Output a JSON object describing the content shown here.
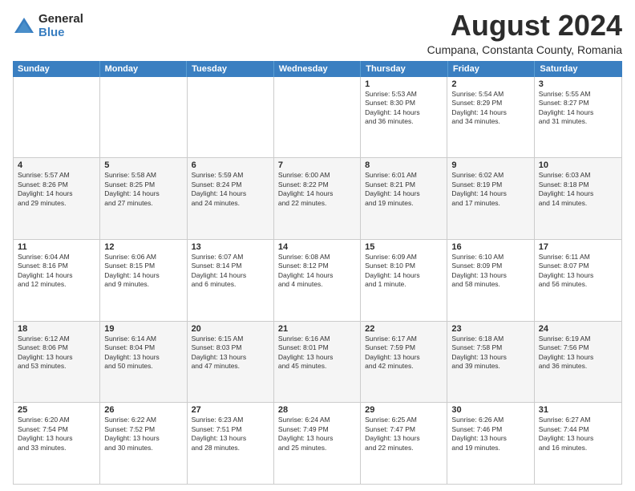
{
  "logo": {
    "general": "General",
    "blue": "Blue"
  },
  "title": "August 2024",
  "location": "Cumpana, Constanta County, Romania",
  "header_days": [
    "Sunday",
    "Monday",
    "Tuesday",
    "Wednesday",
    "Thursday",
    "Friday",
    "Saturday"
  ],
  "rows": [
    [
      {
        "day": "",
        "info": ""
      },
      {
        "day": "",
        "info": ""
      },
      {
        "day": "",
        "info": ""
      },
      {
        "day": "",
        "info": ""
      },
      {
        "day": "1",
        "info": "Sunrise: 5:53 AM\nSunset: 8:30 PM\nDaylight: 14 hours\nand 36 minutes."
      },
      {
        "day": "2",
        "info": "Sunrise: 5:54 AM\nSunset: 8:29 PM\nDaylight: 14 hours\nand 34 minutes."
      },
      {
        "day": "3",
        "info": "Sunrise: 5:55 AM\nSunset: 8:27 PM\nDaylight: 14 hours\nand 31 minutes."
      }
    ],
    [
      {
        "day": "4",
        "info": "Sunrise: 5:57 AM\nSunset: 8:26 PM\nDaylight: 14 hours\nand 29 minutes."
      },
      {
        "day": "5",
        "info": "Sunrise: 5:58 AM\nSunset: 8:25 PM\nDaylight: 14 hours\nand 27 minutes."
      },
      {
        "day": "6",
        "info": "Sunrise: 5:59 AM\nSunset: 8:24 PM\nDaylight: 14 hours\nand 24 minutes."
      },
      {
        "day": "7",
        "info": "Sunrise: 6:00 AM\nSunset: 8:22 PM\nDaylight: 14 hours\nand 22 minutes."
      },
      {
        "day": "8",
        "info": "Sunrise: 6:01 AM\nSunset: 8:21 PM\nDaylight: 14 hours\nand 19 minutes."
      },
      {
        "day": "9",
        "info": "Sunrise: 6:02 AM\nSunset: 8:19 PM\nDaylight: 14 hours\nand 17 minutes."
      },
      {
        "day": "10",
        "info": "Sunrise: 6:03 AM\nSunset: 8:18 PM\nDaylight: 14 hours\nand 14 minutes."
      }
    ],
    [
      {
        "day": "11",
        "info": "Sunrise: 6:04 AM\nSunset: 8:16 PM\nDaylight: 14 hours\nand 12 minutes."
      },
      {
        "day": "12",
        "info": "Sunrise: 6:06 AM\nSunset: 8:15 PM\nDaylight: 14 hours\nand 9 minutes."
      },
      {
        "day": "13",
        "info": "Sunrise: 6:07 AM\nSunset: 8:14 PM\nDaylight: 14 hours\nand 6 minutes."
      },
      {
        "day": "14",
        "info": "Sunrise: 6:08 AM\nSunset: 8:12 PM\nDaylight: 14 hours\nand 4 minutes."
      },
      {
        "day": "15",
        "info": "Sunrise: 6:09 AM\nSunset: 8:10 PM\nDaylight: 14 hours\nand 1 minute."
      },
      {
        "day": "16",
        "info": "Sunrise: 6:10 AM\nSunset: 8:09 PM\nDaylight: 13 hours\nand 58 minutes."
      },
      {
        "day": "17",
        "info": "Sunrise: 6:11 AM\nSunset: 8:07 PM\nDaylight: 13 hours\nand 56 minutes."
      }
    ],
    [
      {
        "day": "18",
        "info": "Sunrise: 6:12 AM\nSunset: 8:06 PM\nDaylight: 13 hours\nand 53 minutes."
      },
      {
        "day": "19",
        "info": "Sunrise: 6:14 AM\nSunset: 8:04 PM\nDaylight: 13 hours\nand 50 minutes."
      },
      {
        "day": "20",
        "info": "Sunrise: 6:15 AM\nSunset: 8:03 PM\nDaylight: 13 hours\nand 47 minutes."
      },
      {
        "day": "21",
        "info": "Sunrise: 6:16 AM\nSunset: 8:01 PM\nDaylight: 13 hours\nand 45 minutes."
      },
      {
        "day": "22",
        "info": "Sunrise: 6:17 AM\nSunset: 7:59 PM\nDaylight: 13 hours\nand 42 minutes."
      },
      {
        "day": "23",
        "info": "Sunrise: 6:18 AM\nSunset: 7:58 PM\nDaylight: 13 hours\nand 39 minutes."
      },
      {
        "day": "24",
        "info": "Sunrise: 6:19 AM\nSunset: 7:56 PM\nDaylight: 13 hours\nand 36 minutes."
      }
    ],
    [
      {
        "day": "25",
        "info": "Sunrise: 6:20 AM\nSunset: 7:54 PM\nDaylight: 13 hours\nand 33 minutes."
      },
      {
        "day": "26",
        "info": "Sunrise: 6:22 AM\nSunset: 7:52 PM\nDaylight: 13 hours\nand 30 minutes."
      },
      {
        "day": "27",
        "info": "Sunrise: 6:23 AM\nSunset: 7:51 PM\nDaylight: 13 hours\nand 28 minutes."
      },
      {
        "day": "28",
        "info": "Sunrise: 6:24 AM\nSunset: 7:49 PM\nDaylight: 13 hours\nand 25 minutes."
      },
      {
        "day": "29",
        "info": "Sunrise: 6:25 AM\nSunset: 7:47 PM\nDaylight: 13 hours\nand 22 minutes."
      },
      {
        "day": "30",
        "info": "Sunrise: 6:26 AM\nSunset: 7:46 PM\nDaylight: 13 hours\nand 19 minutes."
      },
      {
        "day": "31",
        "info": "Sunrise: 6:27 AM\nSunset: 7:44 PM\nDaylight: 13 hours\nand 16 minutes."
      }
    ]
  ]
}
